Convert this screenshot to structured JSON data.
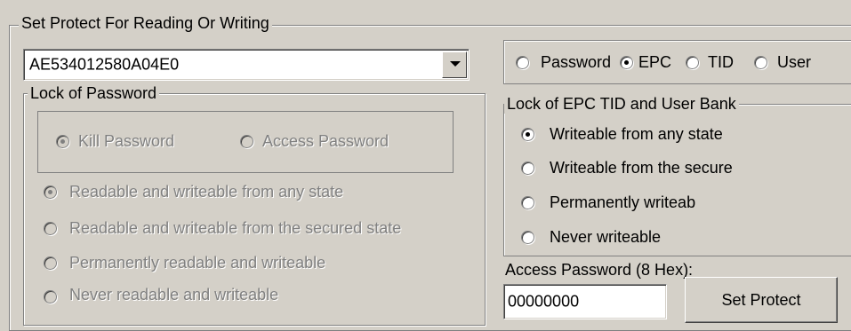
{
  "main_group": {
    "title": "Set Protect For Reading Or Writing"
  },
  "tag_select": {
    "value": "AE534012580A04E0"
  },
  "password_lock": {
    "title": "Lock of Password",
    "target_options": [
      {
        "label": "Kill Password",
        "checked": true
      },
      {
        "label": "Access Password",
        "checked": false
      }
    ],
    "state_options": [
      {
        "label": "Readable and  writeable from any state",
        "checked": true
      },
      {
        "label": "Readable and writeable from the secured state",
        "checked": false
      },
      {
        "label": "Permanently readable and writeable",
        "checked": false
      },
      {
        "label": "Never readable and writeable",
        "checked": false
      }
    ]
  },
  "bank_select": {
    "options": [
      {
        "label": "Password",
        "checked": false
      },
      {
        "label": "EPC",
        "checked": true
      },
      {
        "label": "TID",
        "checked": false
      },
      {
        "label": "User",
        "checked": false
      }
    ]
  },
  "bank_lock": {
    "title": "Lock of EPC TID and User Bank",
    "options": [
      {
        "label": "Writeable from any state",
        "checked": true
      },
      {
        "label": "Writeable from the secure",
        "checked": false
      },
      {
        "label": "Permanently writeab",
        "checked": false
      },
      {
        "label": "Never writeable",
        "checked": false
      }
    ]
  },
  "access_password": {
    "label": "Access Password (8 Hex):",
    "value": "00000000"
  },
  "set_protect_button": {
    "label": "Set Protect"
  }
}
